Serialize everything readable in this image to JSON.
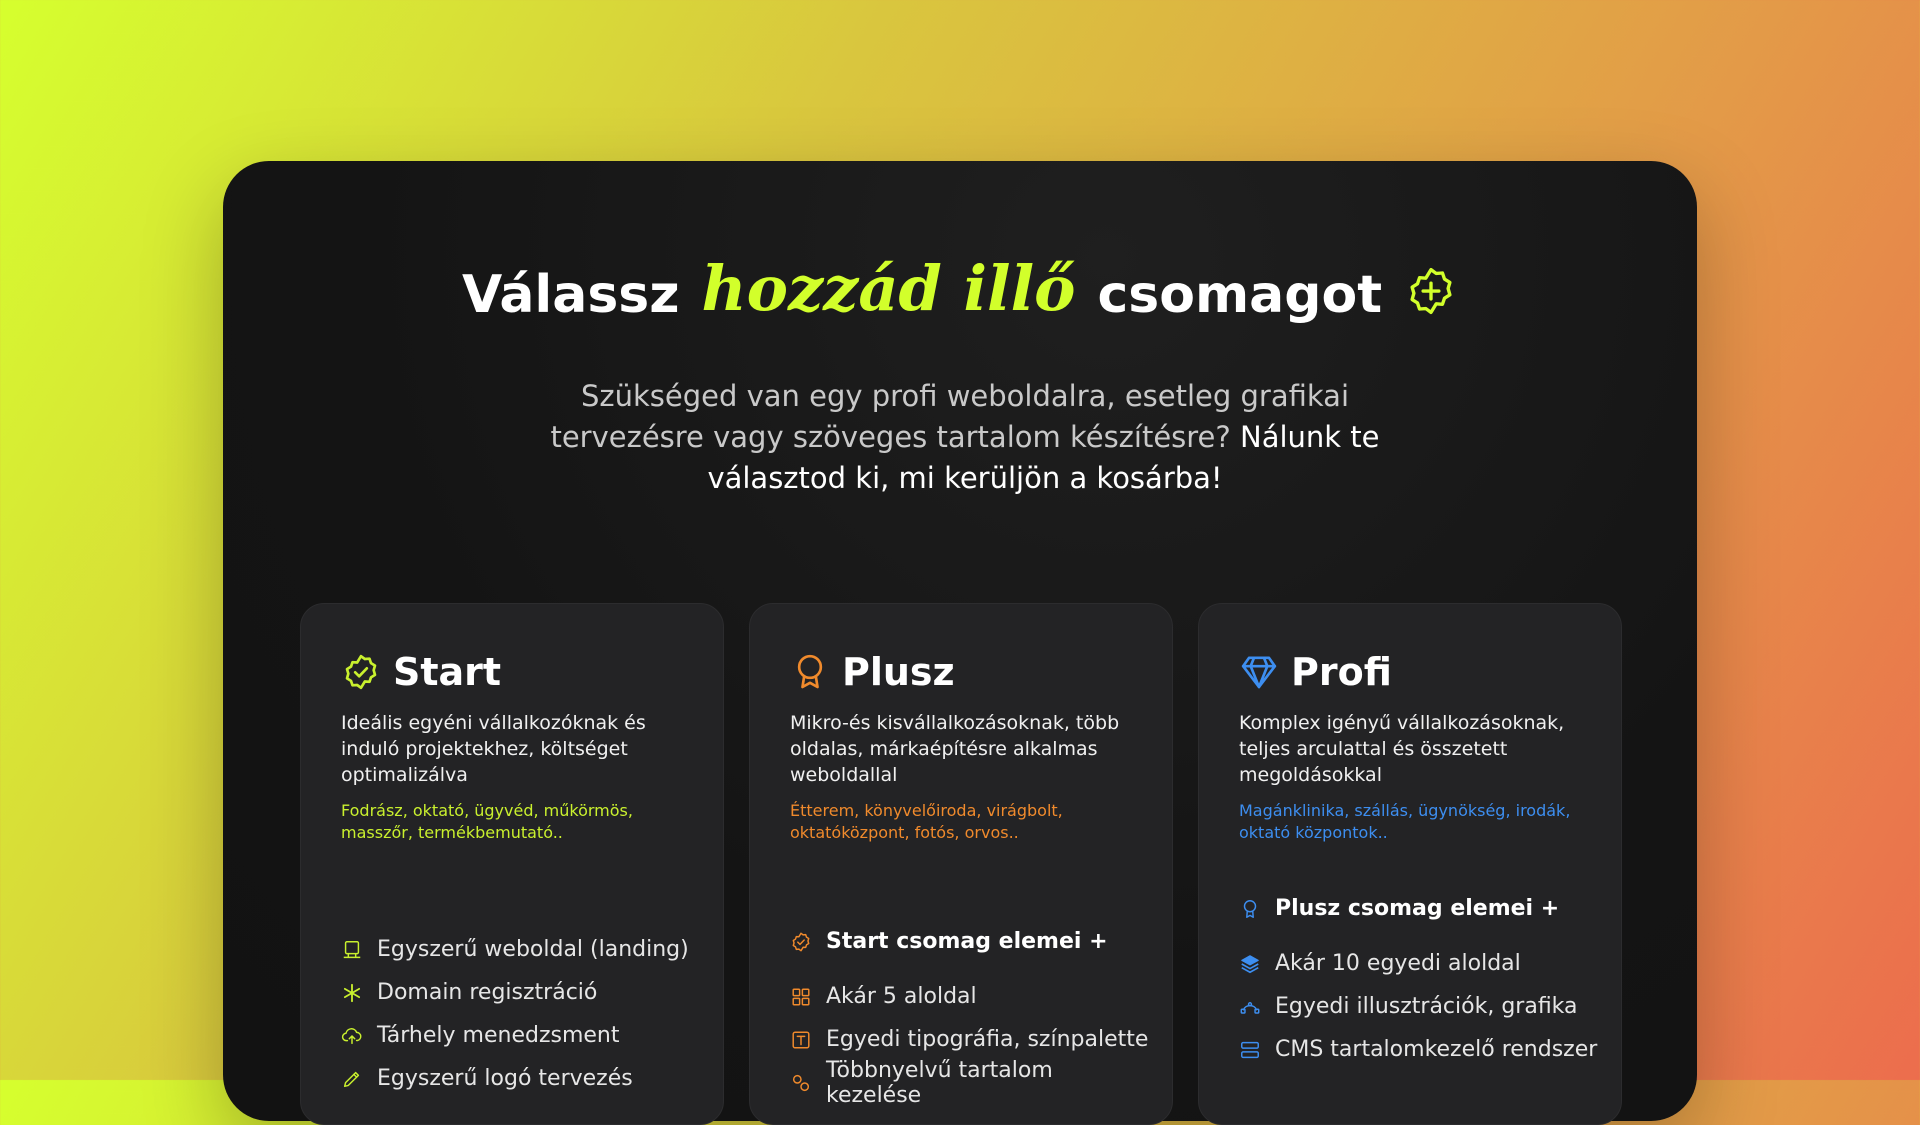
{
  "headline": {
    "before": "Válassz",
    "accent": "hozzád illő",
    "after": "csomagot"
  },
  "subtitle": {
    "muted": "Szükséged van egy profi weboldalra, esetleg grafikai tervezésre vagy szöveges tartalom készítésre?",
    "strong": "Nálunk te választod ki, mi kerüljön a kosárba!"
  },
  "colors": {
    "accent_lime": "#d2ff2b",
    "start": "#c9f02e",
    "plusz": "#f08a2c",
    "profi": "#3d8ef0",
    "panel": "#141414",
    "card": "#232325"
  },
  "cards": [
    {
      "title": "Start",
      "icon": "badge-check-icon",
      "description": "Ideális egyéni vállalkozóknak és induló projektekhez, költséget optimalizálva",
      "tags": "Fodrász, oktató, ügyvéd, műkörmös, masszőr, termékbemutató..",
      "features": [
        {
          "label": "Egyszerű weboldal (landing)",
          "icon": "laptop-icon"
        },
        {
          "label": "Domain regisztráció",
          "icon": "asterisk-icon"
        },
        {
          "label": "Tárhely menedzsment",
          "icon": "cloud-upload-icon"
        },
        {
          "label": "Egyszerű logó tervezés",
          "icon": "pen-icon"
        }
      ]
    },
    {
      "title": "Plusz",
      "icon": "award-icon",
      "description": "Mikro-és kisvállalkozásoknak, több oldalas, márkaépítésre alkalmas weboldallal",
      "tags": "Étterem, könyvelőiroda, virágbolt, oktatóközpont, fotós, orvos..",
      "features": [
        {
          "label": "Start csomag elemei +",
          "icon": "badge-check-icon"
        },
        {
          "label": "Akár 5 aloldal",
          "icon": "grid-icon"
        },
        {
          "label": "Egyedi tipográfia, színpalette",
          "icon": "typography-icon"
        },
        {
          "label": "Többnyelvű tartalom kezelése",
          "icon": "language-icon"
        }
      ]
    },
    {
      "title": "Profi",
      "icon": "diamond-icon",
      "description": "Komplex igényű vállalkozásoknak, teljes arculattal és összetett megoldásokkal",
      "tags": "Magánklinika, szállás, ügynökség, irodák, oktató központok..",
      "features": [
        {
          "label": "Plusz csomag elemei +",
          "icon": "award-icon"
        },
        {
          "label": "Akár 10 egyedi aloldal",
          "icon": "layers-icon"
        },
        {
          "label": "Egyedi illusztrációk, grafika",
          "icon": "vector-icon"
        },
        {
          "label": "CMS tartalomkezelő rendszer",
          "icon": "server-icon"
        }
      ]
    }
  ]
}
